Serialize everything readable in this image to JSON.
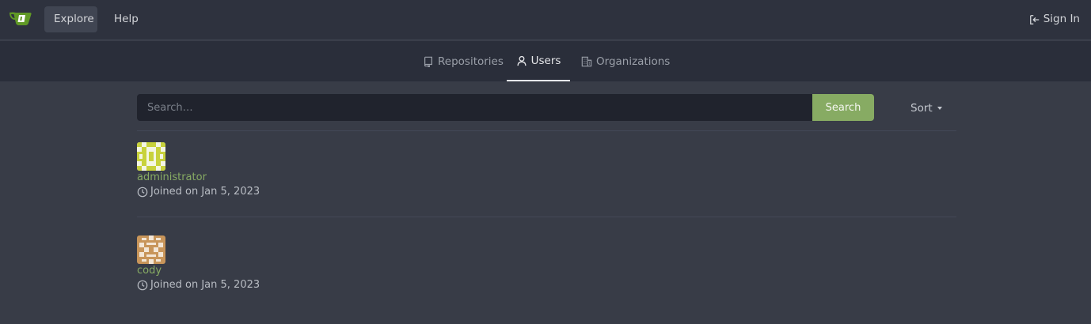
{
  "nav": {
    "explore": "Explore",
    "help": "Help",
    "sign_in": "Sign In"
  },
  "tabs": [
    {
      "label": "Repositories",
      "icon": "repo-icon"
    },
    {
      "label": "Users",
      "icon": "person-icon",
      "active": true
    },
    {
      "label": "Organizations",
      "icon": "organization-icon"
    }
  ],
  "search": {
    "placeholder": "Search…",
    "value": "",
    "button_label": "Search",
    "sort_label": "Sort"
  },
  "users": [
    {
      "name": "administrator",
      "joined": "Joined on Jan 5, 2023",
      "avatar_color": "#c8d23c"
    },
    {
      "name": "cody",
      "joined": "Joined on Jan 5, 2023",
      "avatar_color": "#c8955a"
    }
  ],
  "colors": {
    "accent": "#87ab63",
    "background": "#383c47",
    "nav_background": "#2e323e"
  }
}
